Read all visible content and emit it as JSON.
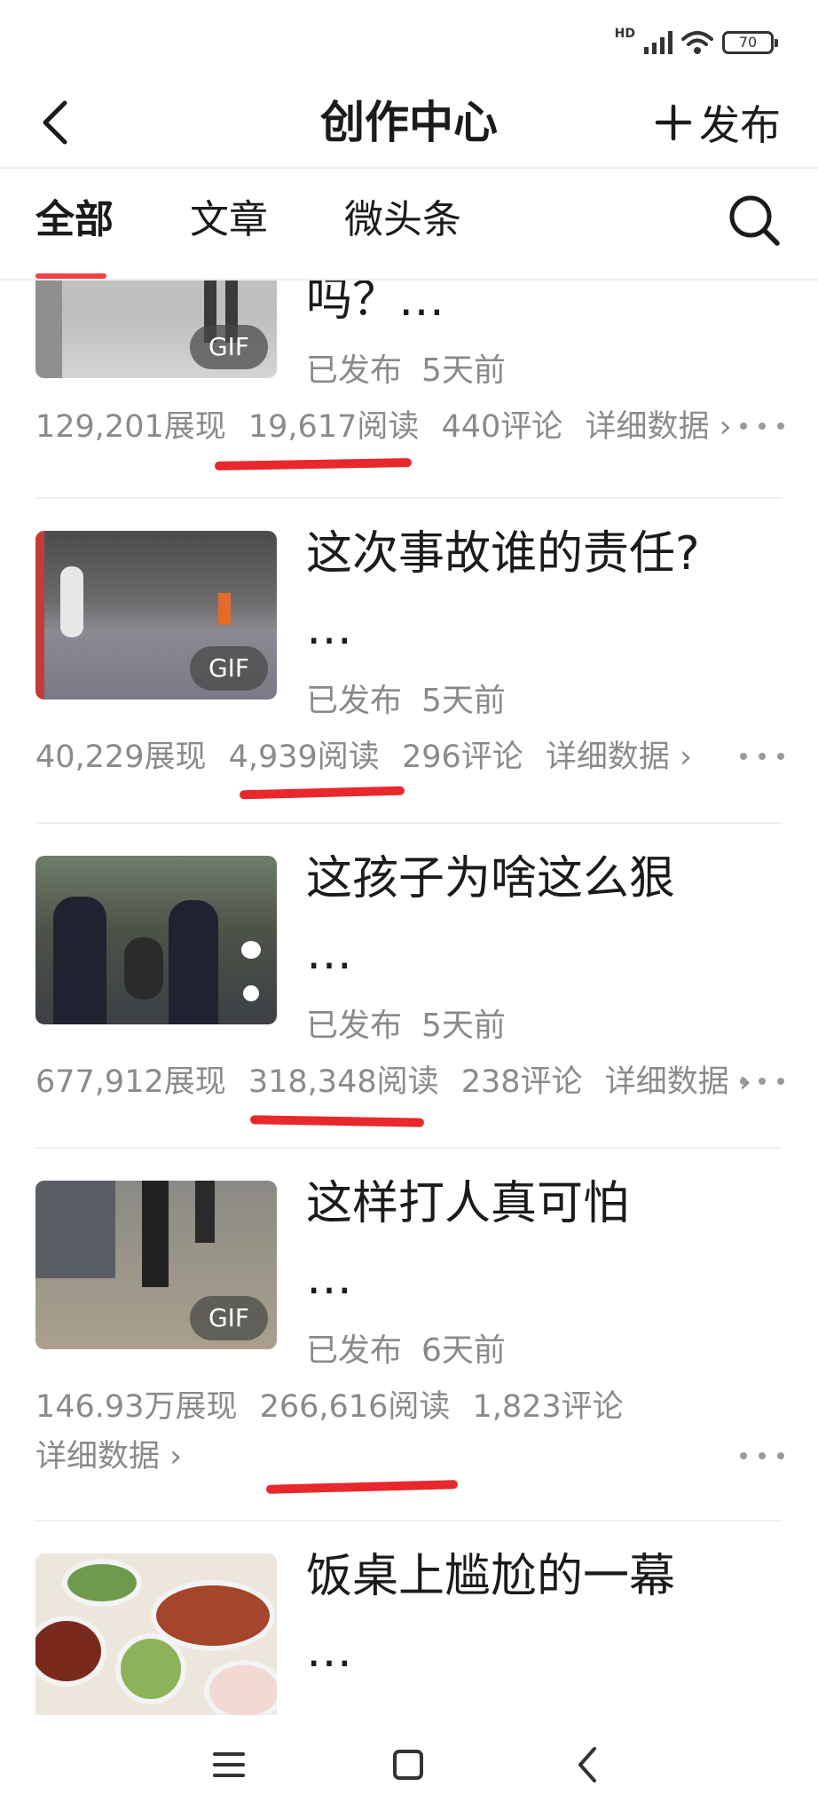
{
  "status_bar": {
    "network_label": "HD",
    "battery": "70"
  },
  "header": {
    "title": "创作中心",
    "publish_label": "发布"
  },
  "tabs": [
    {
      "label": "全部",
      "active": true
    },
    {
      "label": "文章",
      "active": false
    },
    {
      "label": "微头条",
      "active": false
    }
  ],
  "posts": [
    {
      "title": "吗？…",
      "gif_badge": "GIF",
      "status": "已发布",
      "time": "5天前",
      "impressions": "129,201展现",
      "reads": "19,617阅读",
      "comments": "440评论",
      "detail": "详细数据 ›"
    },
    {
      "title_line1": "这次事故谁的责任?",
      "title_line2": "…",
      "gif_badge": "GIF",
      "status": "已发布",
      "time": "5天前",
      "impressions": "40,229展现",
      "reads": "4,939阅读",
      "comments": "296评论",
      "detail": "详细数据 ›"
    },
    {
      "title_line1": "这孩子为啥这么狠",
      "title_line2": "…",
      "status": "已发布",
      "time": "5天前",
      "impressions": "677,912展现",
      "reads": "318,348阅读",
      "comments": "238评论",
      "detail": "详细数据 ›"
    },
    {
      "title_line1": "这样打人真可怕",
      "title_line2": "…",
      "gif_badge": "GIF",
      "status": "已发布",
      "time": "6天前",
      "impressions": "146.93万展现",
      "reads": "266,616阅读",
      "comments": "1,823评论",
      "detail": "详细数据 ›"
    },
    {
      "title_line1": "饭桌上尴尬的一幕",
      "title_line2": "…"
    }
  ],
  "icons": {
    "back": "chevron-left-icon",
    "publish": "plus-icon",
    "search": "search-icon",
    "more": "more-dots-icon",
    "nav_menu": "menu-icon",
    "nav_home": "square-home-icon",
    "nav_back": "back-triangle-icon"
  },
  "colors": {
    "accent": "#f04142",
    "text": "#1b1b1b",
    "muted": "#8a8a8a",
    "marker": "#e8282d"
  }
}
